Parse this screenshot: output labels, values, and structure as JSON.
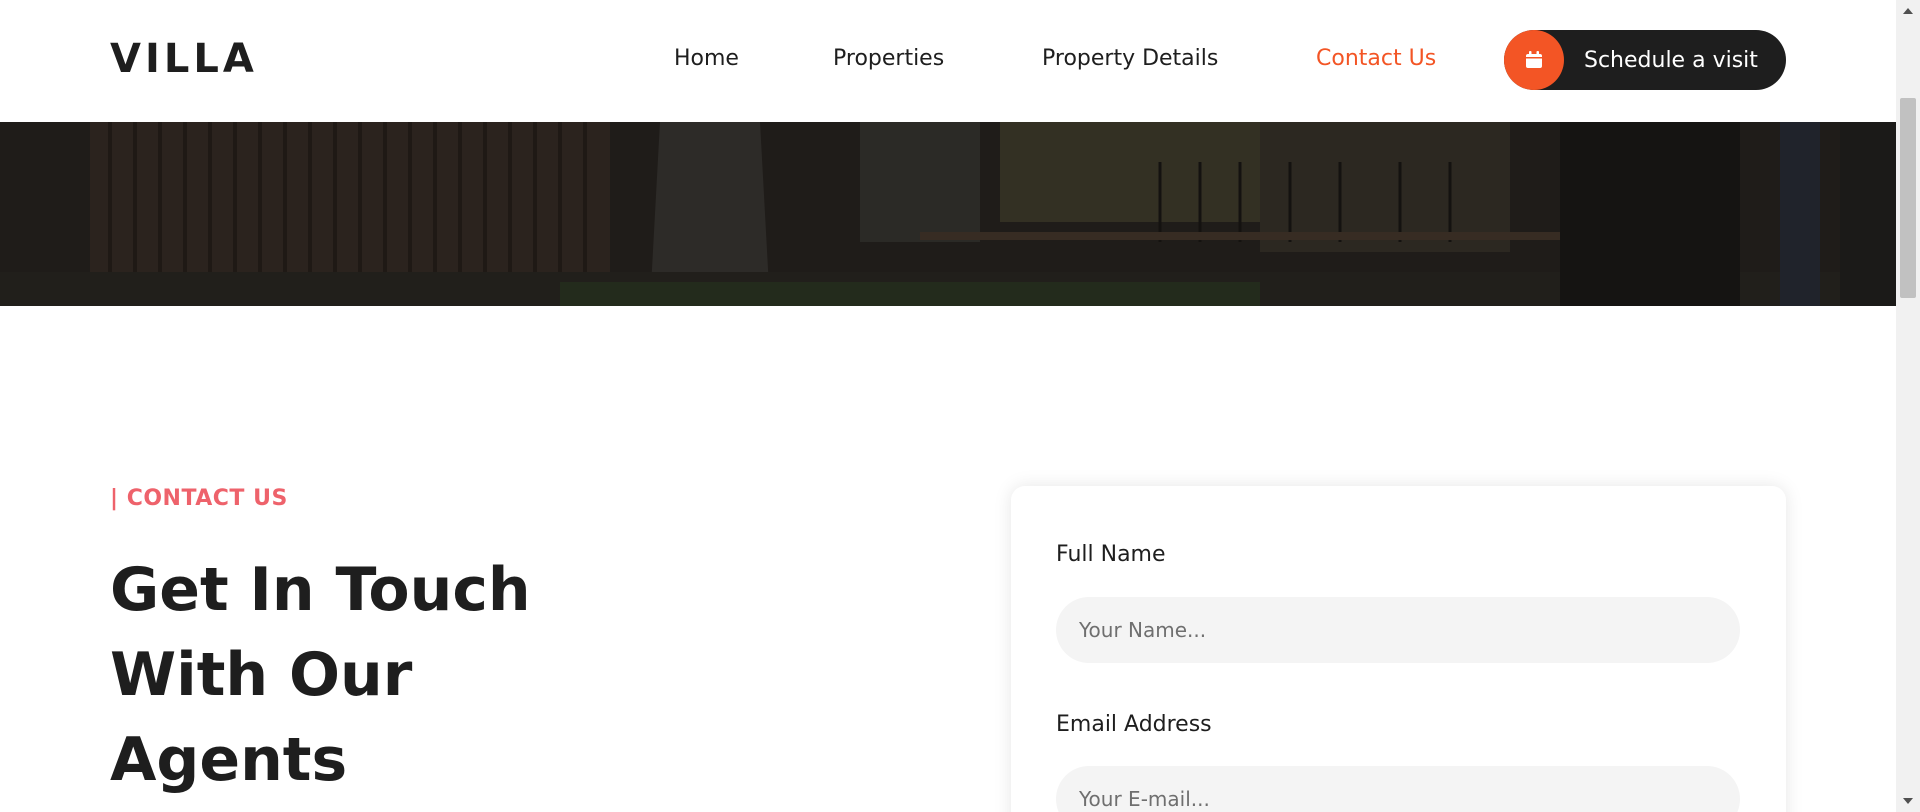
{
  "brand": {
    "logo": "VILLA",
    "accent_color": "#f35525",
    "eyebrow_color": "#ee626b",
    "dark_color": "#1e1e1e"
  },
  "nav": {
    "items": [
      {
        "label": "Home",
        "active": false
      },
      {
        "label": "Properties",
        "active": false
      },
      {
        "label": "Property Details",
        "active": false
      },
      {
        "label": "Contact Us",
        "active": true
      }
    ],
    "cta": {
      "label": "Schedule a visit",
      "icon": "calendar-icon"
    }
  },
  "section": {
    "eyebrow": "| CONTACT US",
    "heading_lines": [
      "Get In Touch",
      "With Our",
      "Agents"
    ]
  },
  "form": {
    "fields": [
      {
        "label": "Full Name",
        "placeholder": "Your Name..."
      },
      {
        "label": "Email Address",
        "placeholder": "Your E-mail..."
      }
    ]
  }
}
